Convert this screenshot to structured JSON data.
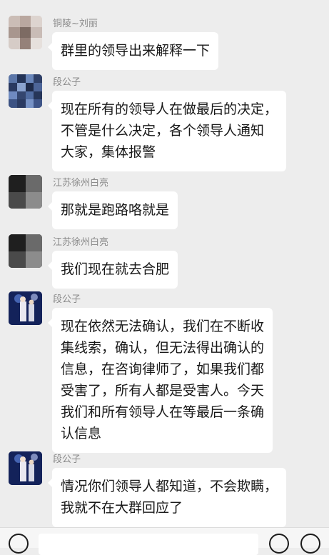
{
  "messages": [
    {
      "sender": "铜陵~刘丽",
      "avatar": "blurred-photo-avatar",
      "lines": [
        "群里的领导出来解释一下"
      ]
    },
    {
      "sender": "段公子",
      "avatar": "pixelated-avatar",
      "lines": [
        "现在所有的领导人在做最后的决定，",
        "不管是什么决定，各个领导人通知",
        "大家，集体报警"
      ]
    },
    {
      "sender": "江苏徐州白亮",
      "avatar": "blurred-dark-avatar",
      "lines": [
        "那就是跑路咯就是"
      ]
    },
    {
      "sender": "江苏徐州白亮",
      "avatar": "blurred-dark-avatar",
      "lines": [
        "我们现在就去合肥"
      ]
    },
    {
      "sender": "段公子",
      "avatar": "stage-photo-avatar",
      "lines": [
        "现在依然无法确认，我们在不断收",
        "集线索，确认，但无法得出确认的",
        "信息，在咨询律师了，如果我们都",
        "受害了，所有人都是受害人。今天",
        "我们和所有领导人在等最后一条确",
        "认信息"
      ]
    },
    {
      "sender": "段公子",
      "avatar": "stage-photo-avatar",
      "lines": [
        "情况你们领导人都知道，不会欺瞒，",
        "我就不在大群回应了"
      ]
    }
  ],
  "input_bar": {
    "voice_icon": "voice-icon",
    "emoji_icon": "emoji-icon",
    "more_icon": "plus-icon"
  },
  "colors": {
    "background": "#ededed",
    "bubble": "#ffffff",
    "sender_text": "#8a8a8a",
    "message_text": "#191919"
  }
}
